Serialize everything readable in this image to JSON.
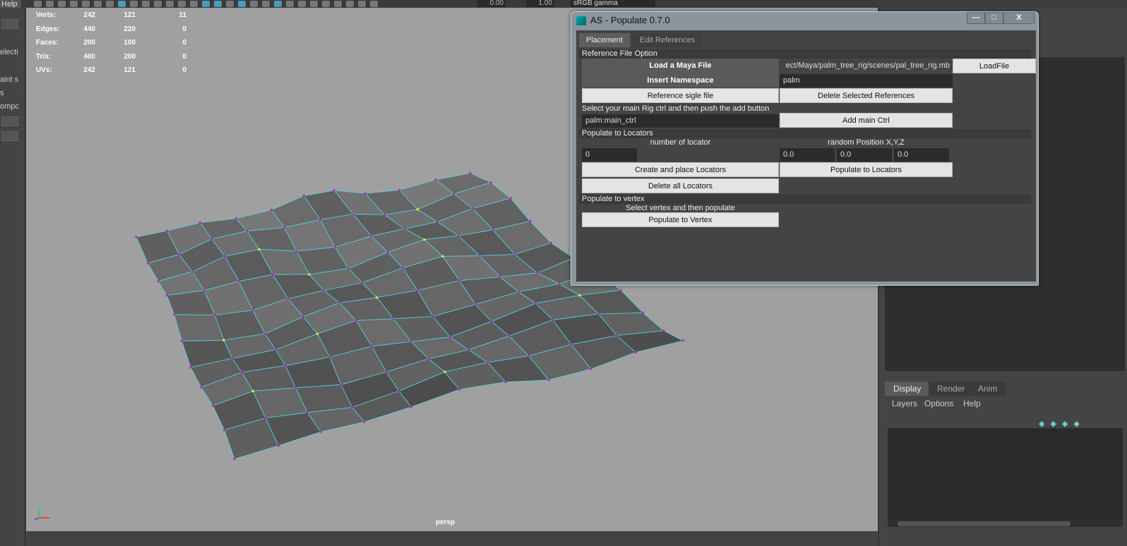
{
  "menubar": {
    "help": "Help"
  },
  "toolbar": {
    "gamma": "sRGB gamma",
    "exposure": "0.00",
    "gamma_value": "1.00"
  },
  "left_panel": {
    "items": [
      "electi",
      "aint s",
      "s",
      "ompc"
    ]
  },
  "hud": {
    "rows": [
      {
        "label": "Verts:",
        "a": "242",
        "b": "121",
        "c": "11"
      },
      {
        "label": "Edges:",
        "a": "440",
        "b": "220",
        "c": "0"
      },
      {
        "label": "Faces:",
        "a": "200",
        "b": "100",
        "c": "0"
      },
      {
        "label": "Tris:",
        "a": "400",
        "b": "200",
        "c": "0"
      },
      {
        "label": "UVs:",
        "a": "242",
        "b": "121",
        "c": "0"
      }
    ]
  },
  "viewport": {
    "camera": "persp",
    "wire_color": "#4fd6e8",
    "vertex_color": "#c020c0",
    "selected_vertex_color": "#f0f020"
  },
  "dialog": {
    "title": "AS - Populate 0.7.0",
    "window_buttons": {
      "minimize": "—",
      "maximize": "□",
      "close": "X"
    },
    "tabs": [
      {
        "label": "Placement",
        "active": true
      },
      {
        "label": "Edit References",
        "active": false
      }
    ],
    "reference_section": "Reference File Option",
    "load_label": "Load a Maya File",
    "file_path": "ect/Maya/palm_tree_rig/scenes/pal_tree_rig.mb",
    "load_button": "LoadFile",
    "namespace_label": "Insert Namespace",
    "namespace_value": "palm",
    "reference_button": "Reference sigle file",
    "delete_refs_button": "Delete Selected References",
    "rig_instruction": "Select your main Rig ctrl and then push the add button",
    "main_ctrl_value": "palm:main_ctrl",
    "add_ctrl_button": "Add main Ctrl",
    "locators_section": "Populate to Locators",
    "num_locator_label": "number of locator",
    "num_locator_value": "0",
    "random_pos_label": "random Position X,Y,Z",
    "random_x": "0.0",
    "random_y": "0.0",
    "random_z": "0.0",
    "create_locators_button": "Create and place Locators",
    "populate_locators_button": "Populate to Locators",
    "delete_locators_button": "Delete all Locators",
    "vertex_section": "Populate to vertex",
    "vertex_instruction": "Select vertex and then populate",
    "populate_vertex_button": "Populate to Vertex"
  },
  "right_panel": {
    "tabs": [
      {
        "label": "Display",
        "active": true
      },
      {
        "label": "Render",
        "active": false
      },
      {
        "label": "Anim",
        "active": false
      }
    ],
    "menu": [
      "Layers",
      "Options",
      "Help"
    ]
  }
}
